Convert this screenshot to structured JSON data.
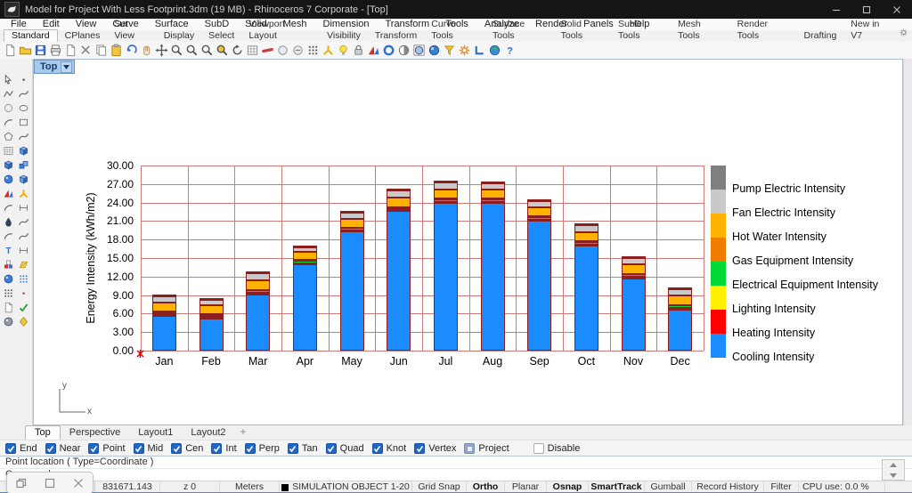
{
  "window": {
    "title": "Model for Project With Less Footprint.3dm (19 MB) - Rhinoceros 7 Corporate - [Top]",
    "controls": [
      "minimize",
      "restore",
      "close"
    ]
  },
  "menubar": {
    "items": [
      "File",
      "Edit",
      "View",
      "Curve",
      "Surface",
      "SubD",
      "Solid",
      "Mesh",
      "Dimension",
      "Transform",
      "Tools",
      "Analyze",
      "Render",
      "Panels",
      "Help"
    ]
  },
  "toolbar_tabs": {
    "active": "Standard",
    "items": [
      "Standard",
      "CPlanes",
      "Set View",
      "Display",
      "Select",
      "Viewport Layout",
      "Visibility",
      "Transform",
      "Curve Tools",
      "Surface Tools",
      "Solid Tools",
      "SubD Tools",
      "Mesh Tools",
      "Render Tools",
      "Drafting",
      "New in V7"
    ]
  },
  "toolbar_icons": [
    {
      "name": "new-document-icon",
      "shape": "page"
    },
    {
      "name": "open-file-icon",
      "shape": "folder"
    },
    {
      "name": "save-icon",
      "shape": "floppy",
      "c1": "#3f6fd4"
    },
    {
      "name": "print-icon",
      "shape": "printer"
    },
    {
      "name": "properties-icon",
      "shape": "page"
    },
    {
      "name": "cut-icon",
      "shape": "x",
      "c1": "#808080"
    },
    {
      "name": "copy-icon",
      "shape": "pages"
    },
    {
      "name": "paste-icon",
      "shape": "clipboard"
    },
    {
      "name": "undo-icon",
      "shape": "undo",
      "c1": "#3f6fd4"
    },
    {
      "name": "pan-icon",
      "shape": "hand"
    },
    {
      "name": "move-icon",
      "shape": "move"
    },
    {
      "name": "zoom-icon",
      "shape": "mag"
    },
    {
      "name": "zoom-window-icon",
      "shape": "mag"
    },
    {
      "name": "zoom-dynamic-icon",
      "shape": "mag"
    },
    {
      "name": "zoom-selected-icon",
      "shape": "mag",
      "c2": "#eac43e"
    },
    {
      "name": "rotate-view-icon",
      "shape": "rotate"
    },
    {
      "name": "cplane-grid-icon",
      "shape": "grid"
    },
    {
      "name": "named-view-icon",
      "shape": "tube",
      "c1": "#cf3a3a"
    },
    {
      "name": "shade-icon",
      "shape": "circle",
      "c1": "#ececec"
    },
    {
      "name": "hide-objects-icon",
      "shape": "circlemin"
    },
    {
      "name": "osnap-points-icon",
      "shape": "dots3",
      "c1": "#555555"
    },
    {
      "name": "select-burst-icon",
      "shape": "burst"
    },
    {
      "name": "lights-icon",
      "shape": "bulb"
    },
    {
      "name": "lock-icon",
      "shape": "lock"
    },
    {
      "name": "layer-tools-icon",
      "shape": "wedges"
    },
    {
      "name": "render-icon",
      "shape": "ring",
      "c1": "#2f6fd0"
    },
    {
      "name": "shaded-viewport-icon",
      "shape": "half"
    },
    {
      "name": "rendered-viewport-icon",
      "shape": "sphereframe"
    },
    {
      "name": "raytrace-icon",
      "shape": "sphere",
      "c1": "#3a7fd4"
    },
    {
      "name": "selection-filter-icon",
      "shape": "funnel"
    },
    {
      "name": "options-icon",
      "shape": "gear",
      "c1": "#e08820"
    },
    {
      "name": "layouts-icon",
      "shape": "L",
      "c1": "#3a6fd4"
    },
    {
      "name": "worldmap-icon",
      "shape": "globe"
    },
    {
      "name": "help-icon",
      "shape": "glyph",
      "glyph": "?",
      "c1": "#2f6fd0"
    }
  ],
  "left_toolbar_icons": [
    {
      "name": "select-arrow-icon",
      "shape": "arrow"
    },
    {
      "name": "point-icon",
      "shape": "dot",
      "c1": "#444444"
    },
    {
      "name": "polyline-icon",
      "shape": "polyline"
    },
    {
      "name": "curve-icon",
      "shape": "curve"
    },
    {
      "name": "circle-icon",
      "shape": "circle"
    },
    {
      "name": "ellipse-icon",
      "shape": "ellipse"
    },
    {
      "name": "arc-icon",
      "shape": "arc"
    },
    {
      "name": "rectangle-icon",
      "shape": "rect"
    },
    {
      "name": "polygon-icon",
      "shape": "polygon"
    },
    {
      "name": "freeform-curve-icon",
      "shape": "curve"
    },
    {
      "name": "surface-patch-icon",
      "shape": "grid"
    },
    {
      "name": "sweep-surface-icon",
      "shape": "cube",
      "c1": "#5a9ae0"
    },
    {
      "name": "box-icon",
      "shape": "cube",
      "c1": "#3a7fd4"
    },
    {
      "name": "solids-icon",
      "shape": "boxes",
      "c1": "#3a7fd4"
    },
    {
      "name": "cylinder-icon",
      "shape": "sphere",
      "c1": "#3a7fd4"
    },
    {
      "name": "surface-tools-icon",
      "shape": "cube",
      "c1": "#6aa4e2"
    },
    {
      "name": "boolean-icon",
      "shape": "wedges"
    },
    {
      "name": "explode-icon",
      "shape": "burst"
    },
    {
      "name": "fillet-icon",
      "shape": "arc"
    },
    {
      "name": "chamfer-icon",
      "shape": "dim"
    },
    {
      "name": "blend-icon",
      "shape": "drop"
    },
    {
      "name": "offset-curve-icon",
      "shape": "curve"
    },
    {
      "name": "curve-tools-icon",
      "shape": "arc"
    },
    {
      "name": "adjust-curve-icon",
      "shape": "curve"
    },
    {
      "name": "text-icon",
      "shape": "glyph",
      "glyph": "T",
      "c1": "#2f6fd0"
    },
    {
      "name": "dimension-icon",
      "shape": "dim"
    },
    {
      "name": "block-icon",
      "shape": "blocks"
    },
    {
      "name": "hatch-icon",
      "shape": "hatch"
    },
    {
      "name": "render-sphere-icon",
      "shape": "sphere",
      "c1": "#3a7fd4"
    },
    {
      "name": "grid-points-icon",
      "shape": "dots3",
      "c1": "#3a7fd4"
    },
    {
      "name": "array-icon",
      "shape": "dots3",
      "c1": "#555555"
    },
    {
      "name": "history-icon",
      "shape": "dot",
      "c1": "#c23333"
    },
    {
      "name": "notes-icon",
      "shape": "page"
    },
    {
      "name": "check-icon",
      "shape": "check",
      "c1": "#2a9e2a"
    },
    {
      "name": "sphere-gray-icon",
      "shape": "sphere",
      "c1": "#9a9a9a"
    },
    {
      "name": "gem-icon",
      "shape": "diamond"
    }
  ],
  "viewport": {
    "label": "Top",
    "axis_indicator": {
      "x": "x",
      "y": "y"
    }
  },
  "chart_data": {
    "type": "bar",
    "stacked": true,
    "title": "",
    "xlabel": "",
    "ylabel": "Energy Intensity (kWh/m2)",
    "ylim": [
      0,
      30
    ],
    "ytick_step": 3,
    "yticks": [
      "0.00",
      "3.00",
      "6.00",
      "9.00",
      "12.00",
      "15.00",
      "18.00",
      "21.00",
      "24.00",
      "27.00",
      "30.00"
    ],
    "grid": true,
    "grid_color": "#CC7B7B",
    "bar_outline_color": "#8B1F1F",
    "categories": [
      "Jan",
      "Feb",
      "Mar",
      "Apr",
      "May",
      "Jun",
      "Jul",
      "Aug",
      "Sep",
      "Oct",
      "Nov",
      "Dec"
    ],
    "series": [
      {
        "name": "Cooling Intensity",
        "color": "#1A8CFF",
        "values": [
          5.6,
          5.2,
          9.1,
          14.0,
          19.3,
          22.6,
          24.0,
          24.0,
          21.1,
          17.0,
          11.7,
          6.6
        ]
      },
      {
        "name": "Heating Intensity",
        "color": "#FF0000",
        "values": [
          0.15,
          0.1,
          0.1,
          0.05,
          0,
          0,
          0,
          0,
          0,
          0.05,
          0.1,
          0.15
        ]
      },
      {
        "name": "Lighting Intensity",
        "color": "#FFF200",
        "values": [
          0.15,
          0.15,
          0.15,
          0.15,
          0.15,
          0.15,
          0.15,
          0.15,
          0.15,
          0.15,
          0.15,
          0.15
        ]
      },
      {
        "name": "Electrical Equipment Intensity",
        "color": "#00D936",
        "values": [
          0.35,
          0.35,
          0.4,
          0.4,
          0.4,
          0.4,
          0.4,
          0.4,
          0.4,
          0.4,
          0.4,
          0.4
        ]
      },
      {
        "name": "Gas Equipment Intensity",
        "color": "#F07D00",
        "values": [
          0.1,
          0.1,
          0.1,
          0.1,
          0.1,
          0.1,
          0.1,
          0.1,
          0.1,
          0.1,
          0.1,
          0.1
        ]
      },
      {
        "name": "Hot Water Intensity",
        "color": "#FFB300",
        "values": [
          1.45,
          1.4,
          1.5,
          1.3,
          1.4,
          1.6,
          1.5,
          1.45,
          1.5,
          1.5,
          1.5,
          1.6
        ]
      },
      {
        "name": "Fan Electric Intensity",
        "color": "#C9C9C9",
        "values": [
          1.0,
          1.0,
          1.15,
          0.8,
          1.05,
          1.1,
          1.05,
          1.0,
          1.05,
          1.2,
          1.0,
          1.0
        ]
      },
      {
        "name": "Pump Electric Intensity",
        "color": "#7F7F7F",
        "values": [
          0.1,
          0.1,
          0.1,
          0.1,
          0.1,
          0.1,
          0.1,
          0.1,
          0.1,
          0.1,
          0.05,
          0.1
        ]
      }
    ],
    "legend_position": "right",
    "legend": [
      {
        "label": "Pump Electric Intensity",
        "color": "#7F7F7F"
      },
      {
        "label": "Fan Electric Intensity",
        "color": "#C9C9C9"
      },
      {
        "label": "Hot Water Intensity",
        "color": "#FFB300"
      },
      {
        "label": "Gas Equipment Intensity",
        "color": "#F07D00"
      },
      {
        "label": "Electrical Equipment Intensity",
        "color": "#00D936"
      },
      {
        "label": "Lighting Intensity",
        "color": "#FFF200"
      },
      {
        "label": "Heating Intensity",
        "color": "#FF0000"
      },
      {
        "label": "Cooling Intensity",
        "color": "#1A8CFF"
      }
    ]
  },
  "viewport_tabs": {
    "active": "Top",
    "items": [
      "Top",
      "Perspective",
      "Layout1",
      "Layout2"
    ],
    "add_tab_glyph": "+"
  },
  "osnap": {
    "checked_items": [
      "End",
      "Near",
      "Point",
      "Mid",
      "Cen",
      "Int",
      "Perp",
      "Tan",
      "Quad",
      "Knot",
      "Vertex"
    ],
    "project": {
      "label": "Project",
      "state": "pressed"
    },
    "disable": {
      "label": "Disable",
      "state": "unchecked"
    }
  },
  "command": {
    "history_line": "Point location ( Type=Coordinate )",
    "prompt": "Command:"
  },
  "statusbar": {
    "coord_y": "831671.143",
    "coord_z": "z 0",
    "units": "Meters",
    "layer": "SIMULATION OBJECT 1-20",
    "panes": [
      {
        "label": "Grid Snap",
        "active": false
      },
      {
        "label": "Ortho",
        "active": true
      },
      {
        "label": "Planar",
        "active": false
      },
      {
        "label": "Osnap",
        "active": true
      },
      {
        "label": "SmartTrack",
        "active": true
      },
      {
        "label": "Gumball",
        "active": false
      },
      {
        "label": "Record History",
        "active": false
      },
      {
        "label": "Filter",
        "active": false
      }
    ],
    "cpu": "CPU use: 0.0 %"
  },
  "overlay_toolbar": {
    "icons": [
      "restore-icon",
      "stop-square-icon",
      "close-icon"
    ]
  }
}
